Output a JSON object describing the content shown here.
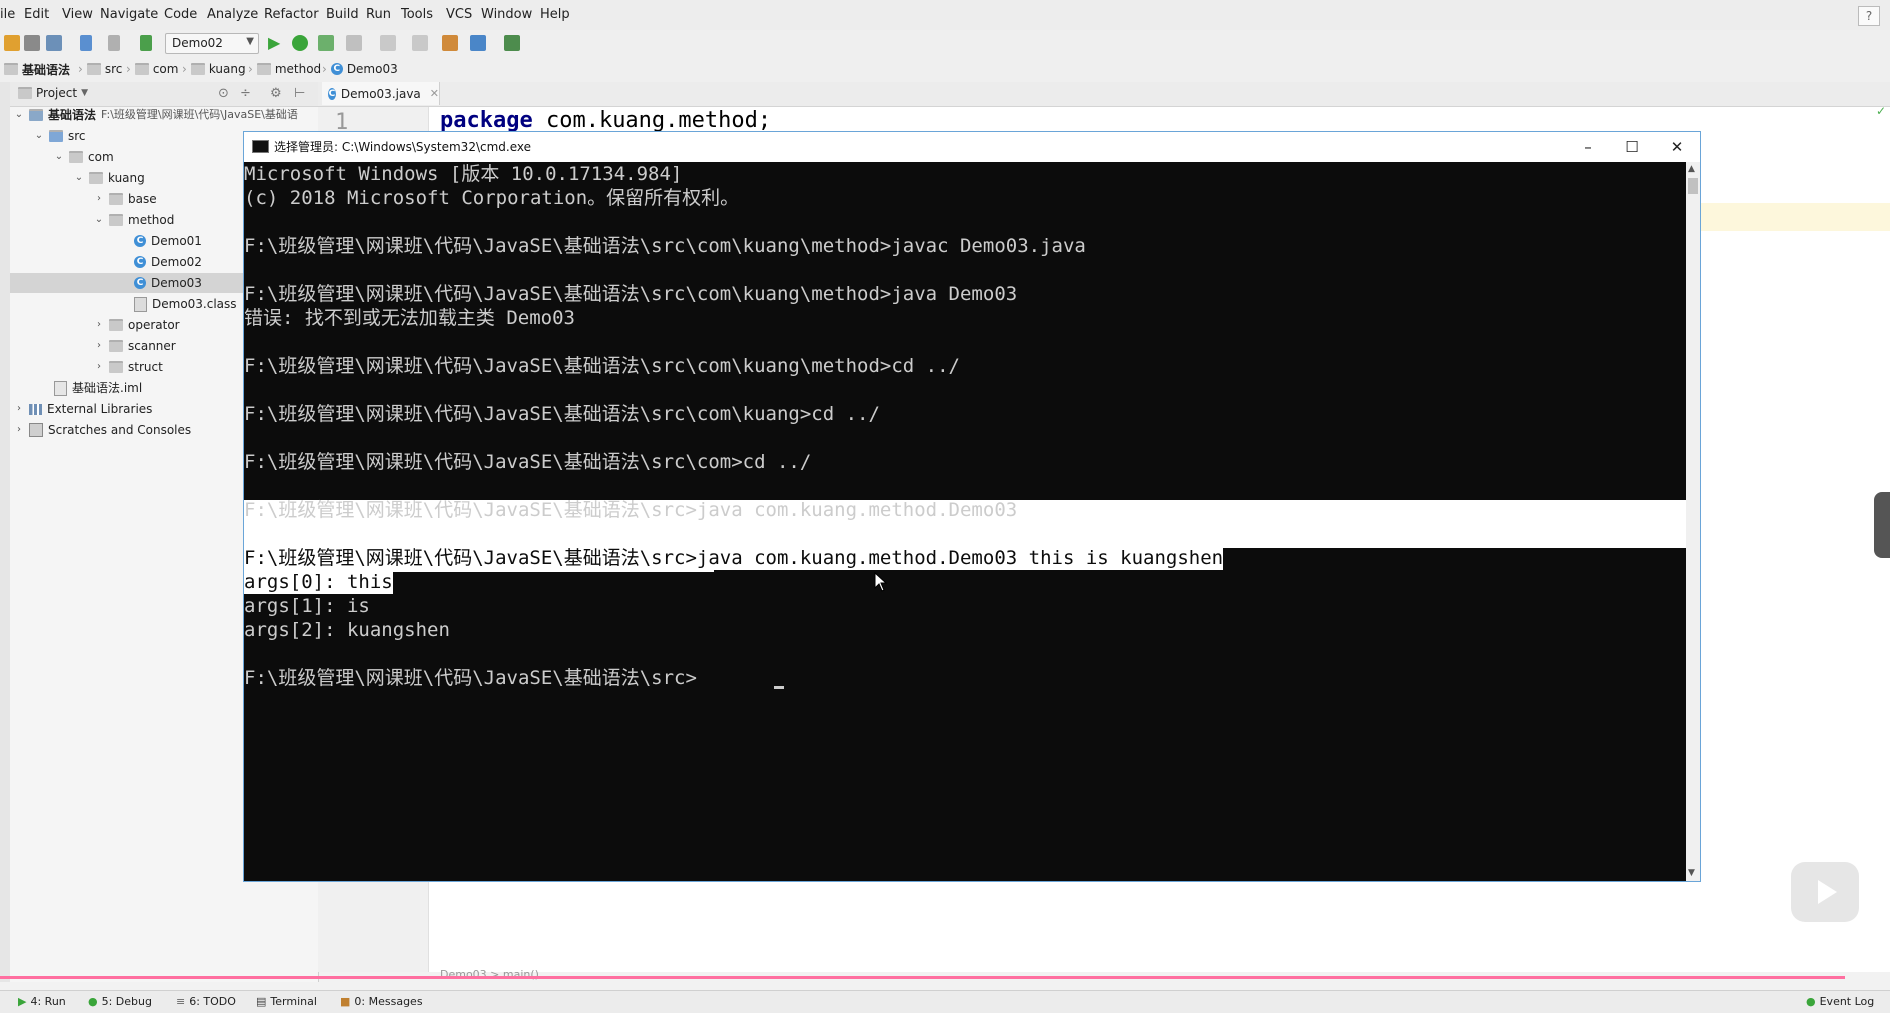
{
  "menu": [
    "ile",
    "Edit",
    "View",
    "Navigate",
    "Code",
    "Analyze",
    "Refactor",
    "Build",
    "Run",
    "Tools",
    "VCS",
    "Window",
    "Help"
  ],
  "help_button": "?",
  "toolbar": {
    "run_config": "Demo02"
  },
  "breadcrumb": [
    "基础语法",
    "src",
    "com",
    "kuang",
    "method",
    "Demo03"
  ],
  "project_panel": {
    "title": "Project",
    "root": {
      "label": "基础语法",
      "path": "F:\\班级管理\\网课班\\代码\\JavaSE\\基础语"
    },
    "tree": [
      {
        "label": "src",
        "kind": "folder"
      },
      {
        "label": "com",
        "kind": "folder"
      },
      {
        "label": "kuang",
        "kind": "folder"
      },
      {
        "label": "base",
        "kind": "folder"
      },
      {
        "label": "method",
        "kind": "folder"
      },
      {
        "label": "Demo01",
        "kind": "class"
      },
      {
        "label": "Demo02",
        "kind": "class"
      },
      {
        "label": "Demo03",
        "kind": "class"
      },
      {
        "label": "Demo03.class",
        "kind": "file"
      },
      {
        "label": "operator",
        "kind": "folder"
      },
      {
        "label": "scanner",
        "kind": "folder"
      },
      {
        "label": "struct",
        "kind": "folder"
      },
      {
        "label": "基础语法.iml",
        "kind": "file"
      },
      {
        "label": "External Libraries",
        "kind": "lib"
      },
      {
        "label": "Scratches and Consoles",
        "kind": "lib"
      }
    ]
  },
  "editor": {
    "tab_label": "Demo03.java",
    "line_number": "1",
    "code_keyword": "package",
    "code_rest": " com.kuang.method;",
    "breadcrumb": "Demo03 > main()"
  },
  "cmd": {
    "title": "选择管理员: C:\\Windows\\System32\\cmd.exe",
    "lines": [
      "Microsoft Windows [版本 10.0.17134.984]",
      "(c) 2018 Microsoft Corporation。保留所有权利。",
      "",
      "F:\\班级管理\\网课班\\代码\\JavaSE\\基础语法\\src\\com\\kuang\\method>javac Demo03.java",
      "",
      "F:\\班级管理\\网课班\\代码\\JavaSE\\基础语法\\src\\com\\kuang\\method>java Demo03",
      "错误: 找不到或无法加载主类 Demo03",
      "",
      "F:\\班级管理\\网课班\\代码\\JavaSE\\基础语法\\src\\com\\kuang\\method>cd ../",
      "",
      "F:\\班级管理\\网课班\\代码\\JavaSE\\基础语法\\src\\com\\kuang>cd ../",
      "",
      "F:\\班级管理\\网课班\\代码\\JavaSE\\基础语法\\src\\com>cd ../",
      "",
      "F:\\班级管理\\网课班\\代码\\JavaSE\\基础语法\\src>java com.kuang.method.Demo03",
      "",
      "F:\\班级管理\\网课班\\代码\\JavaSE\\基础语法\\src>java com.kuang.method.Demo03 this is kuangshen",
      "args[0]: this",
      "args[1]: is",
      "args[2]: kuangshen",
      "",
      "F:\\班级管理\\网课班\\代码\\JavaSE\\基础语法\\src>"
    ]
  },
  "bottom_tools": [
    "4: Run",
    "5: Debug",
    "6: TODO",
    "Terminal",
    "0: Messages",
    "Event Log"
  ],
  "colors": {
    "terminal_bg": "#0c0c0c",
    "terminal_fg": "#cccccc",
    "accent_pink": "#ff6fa0",
    "run_green": "#3aa53a"
  }
}
